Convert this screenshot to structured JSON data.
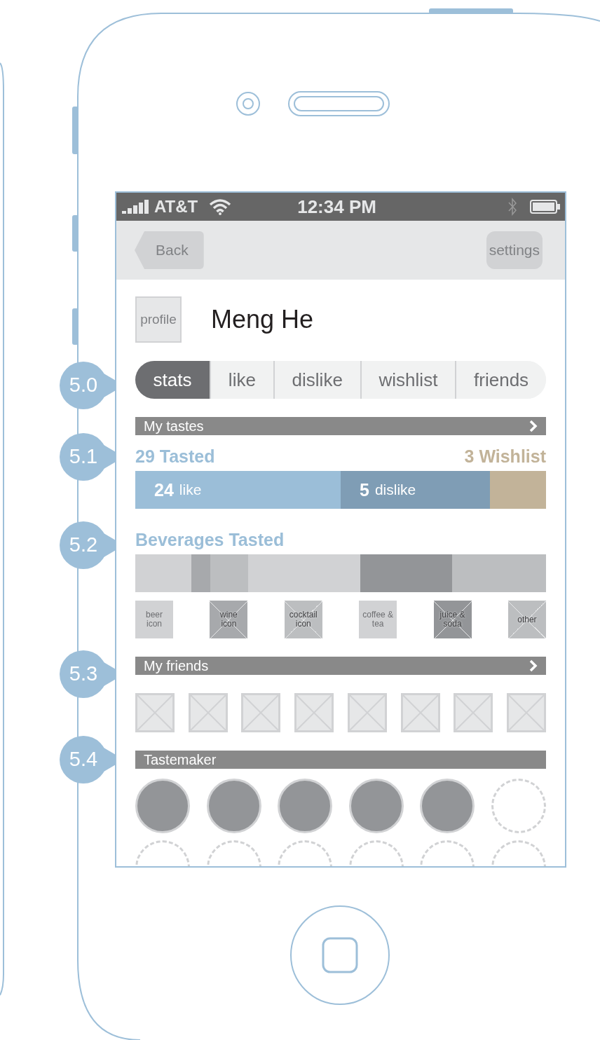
{
  "status_bar": {
    "carrier": "AT&T",
    "time": "12:34 PM"
  },
  "nav_bar": {
    "back": "Back",
    "settings": "settings"
  },
  "profile": {
    "photo_label": "profile",
    "name": "Meng He"
  },
  "tabs": [
    {
      "label": "stats",
      "selected": true
    },
    {
      "label": "like",
      "selected": false
    },
    {
      "label": "dislike",
      "selected": false
    },
    {
      "label": "wishlist",
      "selected": false
    },
    {
      "label": "friends",
      "selected": false
    }
  ],
  "my_tastes": {
    "title": "My tastes",
    "tasted": "29 Tasted",
    "wishlist": "3 Wishlist",
    "segments": [
      {
        "kind": "like",
        "count": "24",
        "label": "like",
        "color": "#9bbed8"
      },
      {
        "kind": "dislike",
        "count": "5",
        "label": "dislike",
        "color": "#7f9db5"
      },
      {
        "kind": "wishlist",
        "color": "#c2b399"
      }
    ]
  },
  "beverages": {
    "title": "Beverages Tasted",
    "segments": [
      {
        "color": "#d1d2d4"
      },
      {
        "color": "#a7a9ac"
      },
      {
        "color": "#bcbec0"
      },
      {
        "color": "#d1d2d4"
      },
      {
        "color": "#939598"
      },
      {
        "color": "#bcbec0"
      }
    ],
    "icons": [
      {
        "label": "beer icon",
        "color": "#d1d2d4",
        "crossed": false
      },
      {
        "label": "wine icon",
        "color": "#a7a9ac",
        "crossed": true
      },
      {
        "label": "cocktail icon",
        "color": "#bcbec0",
        "crossed": true
      },
      {
        "label": "coffee & tea",
        "color": "#d1d2d4",
        "crossed": false
      },
      {
        "label": "juice & soda",
        "color": "#939598",
        "crossed": true
      },
      {
        "label": "other",
        "color": "#bcbec0",
        "crossed": true
      }
    ]
  },
  "friends": {
    "title": "My friends",
    "thumbnails": [
      {
        "kind": "placeholder"
      },
      {
        "kind": "placeholder"
      },
      {
        "kind": "placeholder"
      },
      {
        "kind": "placeholder"
      },
      {
        "kind": "placeholder"
      },
      {
        "kind": "placeholder"
      },
      {
        "kind": "placeholder"
      },
      {
        "kind": "placeholder"
      }
    ]
  },
  "tastemaker": {
    "title": "Tastemaker",
    "badges": [
      {
        "filled": true
      },
      {
        "filled": true
      },
      {
        "filled": true
      },
      {
        "filled": true
      },
      {
        "filled": true
      },
      {
        "filled": false
      }
    ]
  },
  "annotations": [
    {
      "label": "5.0"
    },
    {
      "label": "5.1"
    },
    {
      "label": "5.2"
    },
    {
      "label": "5.3"
    },
    {
      "label": "5.4"
    }
  ]
}
